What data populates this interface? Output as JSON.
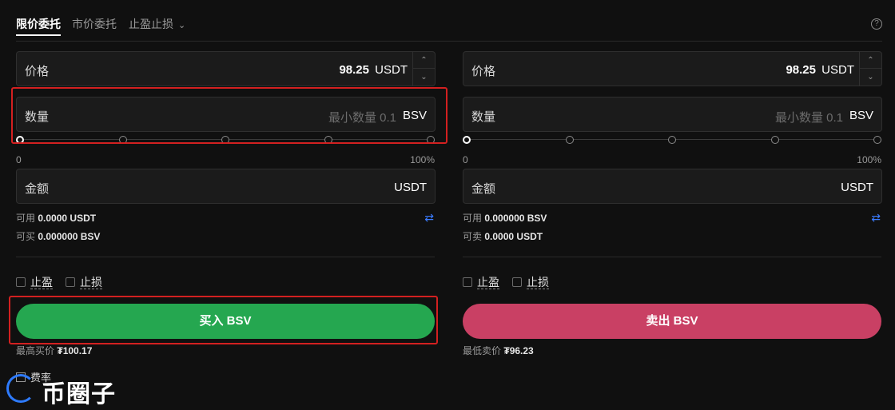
{
  "tabs": [
    {
      "label": "限价委托",
      "active": true
    },
    {
      "label": "市价委托",
      "active": false
    },
    {
      "label": "止盈止损",
      "active": false
    }
  ],
  "buy": {
    "price_label": "价格",
    "price_value": "98.25",
    "price_unit": "USDT",
    "qty_label": "数量",
    "qty_placeholder": "最小数量 0.1",
    "qty_unit": "BSV",
    "slider_min": "0",
    "slider_max": "100%",
    "slider_percent": 0,
    "amount_label": "金额",
    "amount_unit": "USDT",
    "avail_label": "可用",
    "avail_value": "0.0000 USDT",
    "can_label": "可买",
    "can_value": "0.000000 BSV",
    "tp_label": "止盈",
    "sl_label": "止损",
    "action_label": "买入 BSV",
    "best_label": "最高买价",
    "best_value": "₮100.17"
  },
  "sell": {
    "price_label": "价格",
    "price_value": "98.25",
    "price_unit": "USDT",
    "qty_label": "数量",
    "qty_placeholder": "最小数量 0.1",
    "qty_unit": "BSV",
    "slider_min": "0",
    "slider_max": "100%",
    "slider_percent": 0,
    "amount_label": "金额",
    "amount_unit": "USDT",
    "avail_label": "可用",
    "avail_value": "0.000000 BSV",
    "can_label": "可卖",
    "can_value": "0.0000 USDT",
    "tp_label": "止盈",
    "sl_label": "止损",
    "action_label": "卖出 BSV",
    "best_label": "最低卖价",
    "best_value": "₮96.23"
  },
  "fee_label": "费率",
  "watermark_text": "币圈子",
  "colors": {
    "buy": "#25a750",
    "sell": "#c94064",
    "highlight": "#d32020",
    "accent": "#3b7bff"
  },
  "icons": [
    "chevron-down-icon",
    "help-icon",
    "swap-icon",
    "chevron-up-icon"
  ]
}
